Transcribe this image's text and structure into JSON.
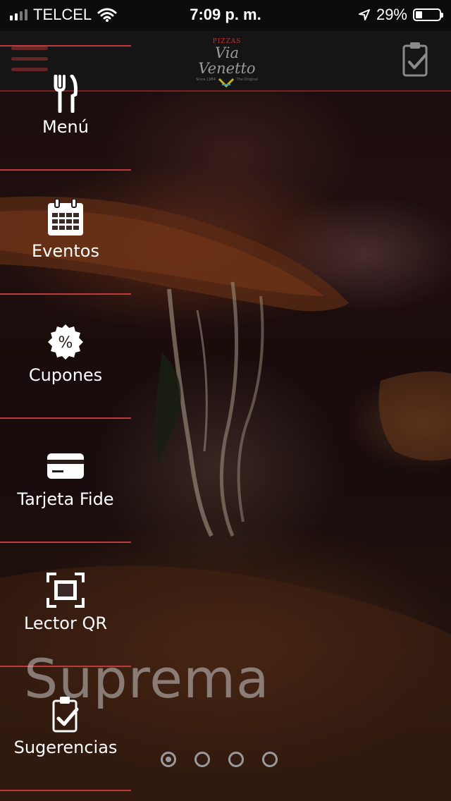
{
  "status_bar": {
    "carrier": "TELCEL",
    "time": "7:09 p. m.",
    "battery": "29%",
    "battery_level": 0.29
  },
  "header": {
    "logo_top": "PIZZAS",
    "logo_name": "Via Venetto",
    "logo_left": "Since 1984",
    "logo_right": "The Original",
    "menu_icon": "hamburger-icon",
    "action_icon": "clipboard-check-icon"
  },
  "menu": {
    "items": [
      {
        "label": "Menú",
        "icon": "fork-knife-icon"
      },
      {
        "label": "Eventos",
        "icon": "calendar-icon"
      },
      {
        "label": "Cupones",
        "icon": "percent-badge-icon"
      },
      {
        "label": "Tarjeta Fide",
        "icon": "credit-card-icon"
      },
      {
        "label": "Lector QR",
        "icon": "qr-scan-icon"
      },
      {
        "label": "Sugerencias",
        "icon": "clipboard-check-icon"
      }
    ]
  },
  "slider": {
    "caption": "Suprema",
    "pages": 4,
    "active_page": 1
  },
  "colors": {
    "accent": "#c0393b",
    "header_bg": "#151515"
  }
}
